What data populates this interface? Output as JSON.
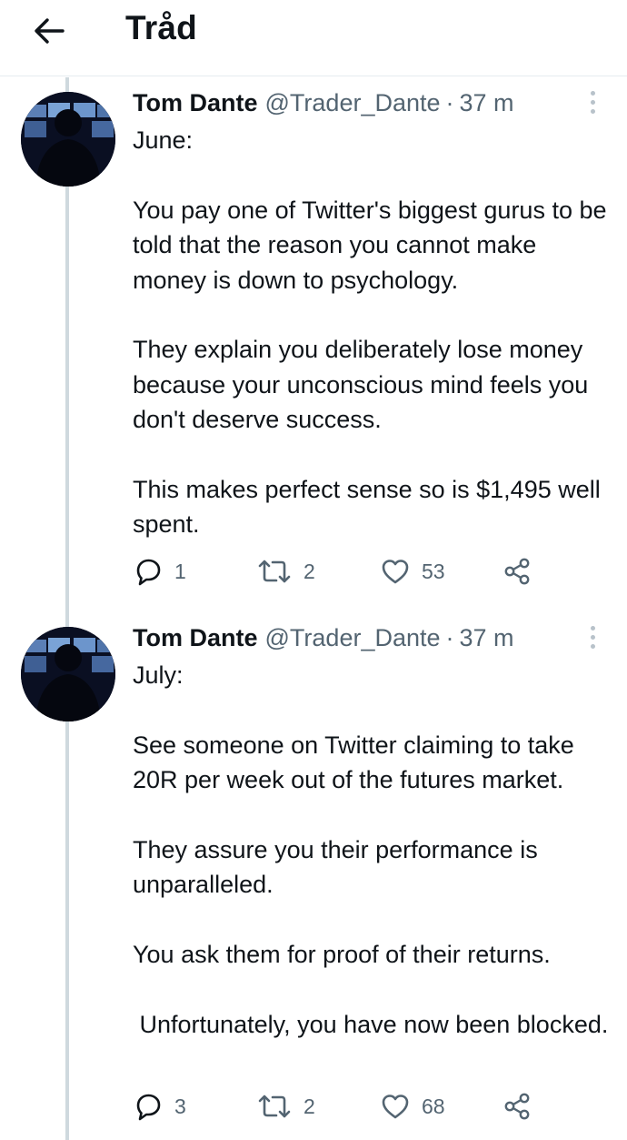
{
  "header": {
    "title": "Tråd",
    "back_icon": "arrow-left-icon"
  },
  "tweets": [
    {
      "author": {
        "name": "Tom Dante",
        "handle": "@Trader_Dante",
        "separator": "·",
        "time": "37 m"
      },
      "paragraphs": [
        "June:",
        "You pay one of Twitter's biggest gurus to be told that the reason you cannot make money is down to psychology.",
        "They explain you deliberately lose money because your unconscious mind feels you don't deserve success.",
        "This makes perfect sense so is $1,495 well spent."
      ],
      "stats": {
        "replies": "1",
        "retweets": "2",
        "likes": "53"
      }
    },
    {
      "author": {
        "name": "Tom Dante",
        "handle": "@Trader_Dante",
        "separator": "·",
        "time": "37 m"
      },
      "paragraphs": [
        "July:",
        "See someone on Twitter claiming to take 20R per week out of the futures market.",
        "They assure you their performance is unparalleled.",
        "You ask them for proof of their returns.",
        " Unfortunately, you have now been blocked."
      ],
      "stats": {
        "replies": "3",
        "retweets": "2",
        "likes": "68"
      }
    }
  ],
  "colors": {
    "text": "#0f1419",
    "secondary": "#536471",
    "thread_line": "#cfd9de",
    "divider": "#e6ecf0"
  }
}
